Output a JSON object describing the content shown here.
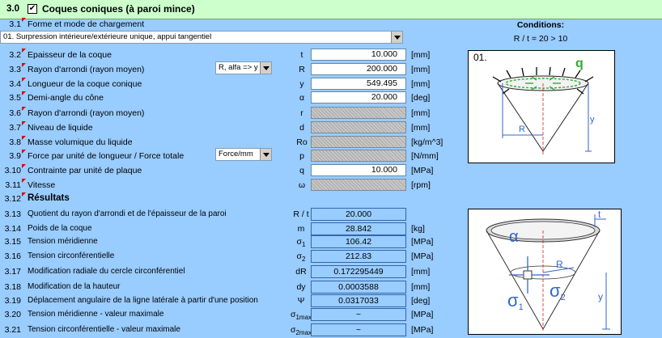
{
  "header": {
    "number": "3.0",
    "checked": "✔",
    "title": "Coques coniques (à paroi mince)"
  },
  "load": {
    "number": "3.1",
    "label": "Forme et mode de chargement",
    "selected": "01. Surpression intérieure/extérieure unique, appui tangentiel"
  },
  "conditions": {
    "title": "Conditions:",
    "text": "R / t = 20 > 10"
  },
  "inputs": [
    {
      "num": "3.2",
      "label": "Epaisseur de la coque",
      "sym": "t",
      "value": "10.000",
      "unit": "[mm]"
    },
    {
      "num": "3.3",
      "label": "Rayon d'arrondi (rayon moyen)",
      "sym": "R",
      "value": "200.000",
      "unit": "[mm]"
    },
    {
      "num": "3.4",
      "label": "Longueur de la coque conique",
      "sym": "y",
      "value": "549.495",
      "unit": "[mm]"
    },
    {
      "num": "3.5",
      "label": "Demi-angle du cône",
      "sym": "α",
      "value": "20.000",
      "unit": "[deg]"
    },
    {
      "num": "3.6",
      "label": "Rayon d'arrondi (rayon moyen)",
      "sym": "r",
      "value": "",
      "unit": "[mm]"
    },
    {
      "num": "3.7",
      "label": "Niveau de liquide",
      "sym": "d",
      "value": "",
      "unit": "[mm]"
    },
    {
      "num": "3.8",
      "label": "Masse volumique du liquide",
      "sym": "Ro",
      "value": "",
      "unit": "[kg/m^3]"
    },
    {
      "num": "3.9",
      "label": "Force par unité de longueur / Force totale",
      "sym": "p",
      "value": "",
      "unit": "[N/mm]"
    },
    {
      "num": "3.10",
      "label": "Contrainte par unité de plaque",
      "sym": "q",
      "value": "10.000",
      "unit": "[MPa]"
    },
    {
      "num": "3.11",
      "label": "Vitesse",
      "sym": "ω",
      "value": "",
      "unit": "[rpm]"
    }
  ],
  "dropdowns": {
    "radius_mode": "R, alfa => y",
    "force_mode": "Force/mm"
  },
  "results": {
    "number": "3.12",
    "title": "Résultats",
    "rows": [
      {
        "num": "3.13",
        "label": "Quotient du rayon d'arrondi et de l'épaisseur de la paroi",
        "sym": "R / t",
        "sub": "",
        "value": "20.000",
        "unit": ""
      },
      {
        "num": "3.14",
        "label": "Poids de la coque",
        "sym": "m",
        "sub": "",
        "value": "28.842",
        "unit": "[kg]"
      },
      {
        "num": "3.15",
        "label": "Tension méridienne",
        "sym": "σ",
        "sub": "1",
        "value": "106.42",
        "unit": "[MPa]"
      },
      {
        "num": "3.16",
        "label": "Tension circonférentielle",
        "sym": "σ",
        "sub": "2",
        "value": "212.83",
        "unit": "[MPa]"
      },
      {
        "num": "3.17",
        "label": "Modification radiale du cercle circonférentiel",
        "sym": "dR",
        "sub": "",
        "value": "0.172295449",
        "unit": "[mm]"
      },
      {
        "num": "3.18",
        "label": "Modification de la hauteur",
        "sym": "dy",
        "sub": "",
        "value": "0.0003588",
        "unit": "[mm]"
      },
      {
        "num": "3.19",
        "label": "Déplacement angulaire de la ligne latérale à partir d'une position",
        "sym": "Ψ",
        "sub": "",
        "value": "0.0317033",
        "unit": "[deg]"
      },
      {
        "num": "3.20",
        "label": "Tension méridienne - valeur maximale",
        "sym": "σ",
        "sub": "1max",
        "value": "~",
        "unit": "[MPa]"
      },
      {
        "num": "3.21",
        "label": "Tension circonférentielle - valeur maximale",
        "sym": "σ",
        "sub": "2max",
        "value": "~",
        "unit": "[MPa]"
      }
    ]
  },
  "figure1": {
    "label": "01.",
    "q": "q",
    "R": "R",
    "y": "y"
  },
  "figure2": {
    "t": "t",
    "alpha": "α",
    "R": "R",
    "sigma1": "σ",
    "sigma1_sub": "1",
    "sigma2": "σ",
    "sigma2_sub": "2",
    "y": "y"
  },
  "colors": {
    "background": "#99ccff",
    "header": "#ccffcc",
    "marker": "#e00000",
    "q_green": "#33aa33",
    "figure_blue": "#3366cc"
  }
}
